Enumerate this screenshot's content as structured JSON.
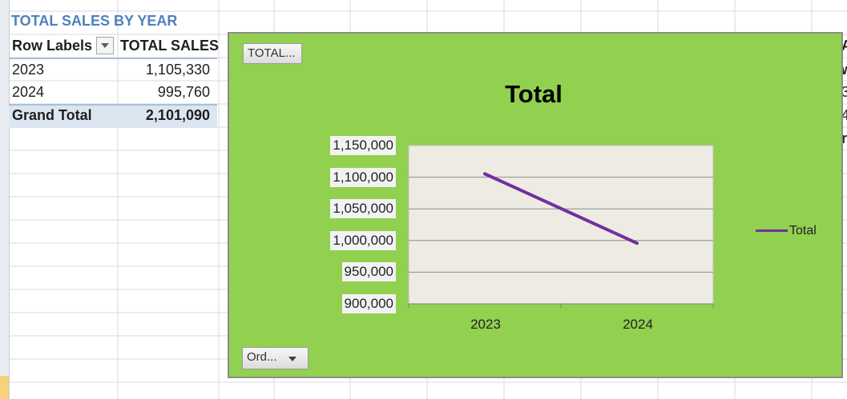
{
  "pivot": {
    "title": "TOTAL SALES BY YEAR",
    "header_row_labels": "Row Labels",
    "header_total_sales": "TOTAL SALES",
    "rows": [
      {
        "label": "2023",
        "value": "1,105,330"
      },
      {
        "label": "2024",
        "value": "995,760"
      }
    ],
    "grand_total_label": "Grand Total",
    "grand_total_value": "2,101,090"
  },
  "chart": {
    "value_field_button": "TOTAL...",
    "axis_field_button": "Ord...",
    "colors": {
      "area": "#92d050",
      "plot": "#eeebe2",
      "line": "#7030a0"
    }
  },
  "chart_data": {
    "type": "line",
    "title": "Total",
    "categories": [
      "2023",
      "2024"
    ],
    "series": [
      {
        "name": "Total",
        "values": [
          1105330,
          995760
        ]
      }
    ],
    "ylim": [
      900000,
      1150000
    ],
    "yticks": [
      "1,150,000",
      "1,100,000",
      "1,050,000",
      "1,000,000",
      "950,000",
      "900,000"
    ],
    "grid": true,
    "legend": "right"
  },
  "edge_text": [
    "A",
    "w",
    "3",
    "4",
    "r"
  ]
}
